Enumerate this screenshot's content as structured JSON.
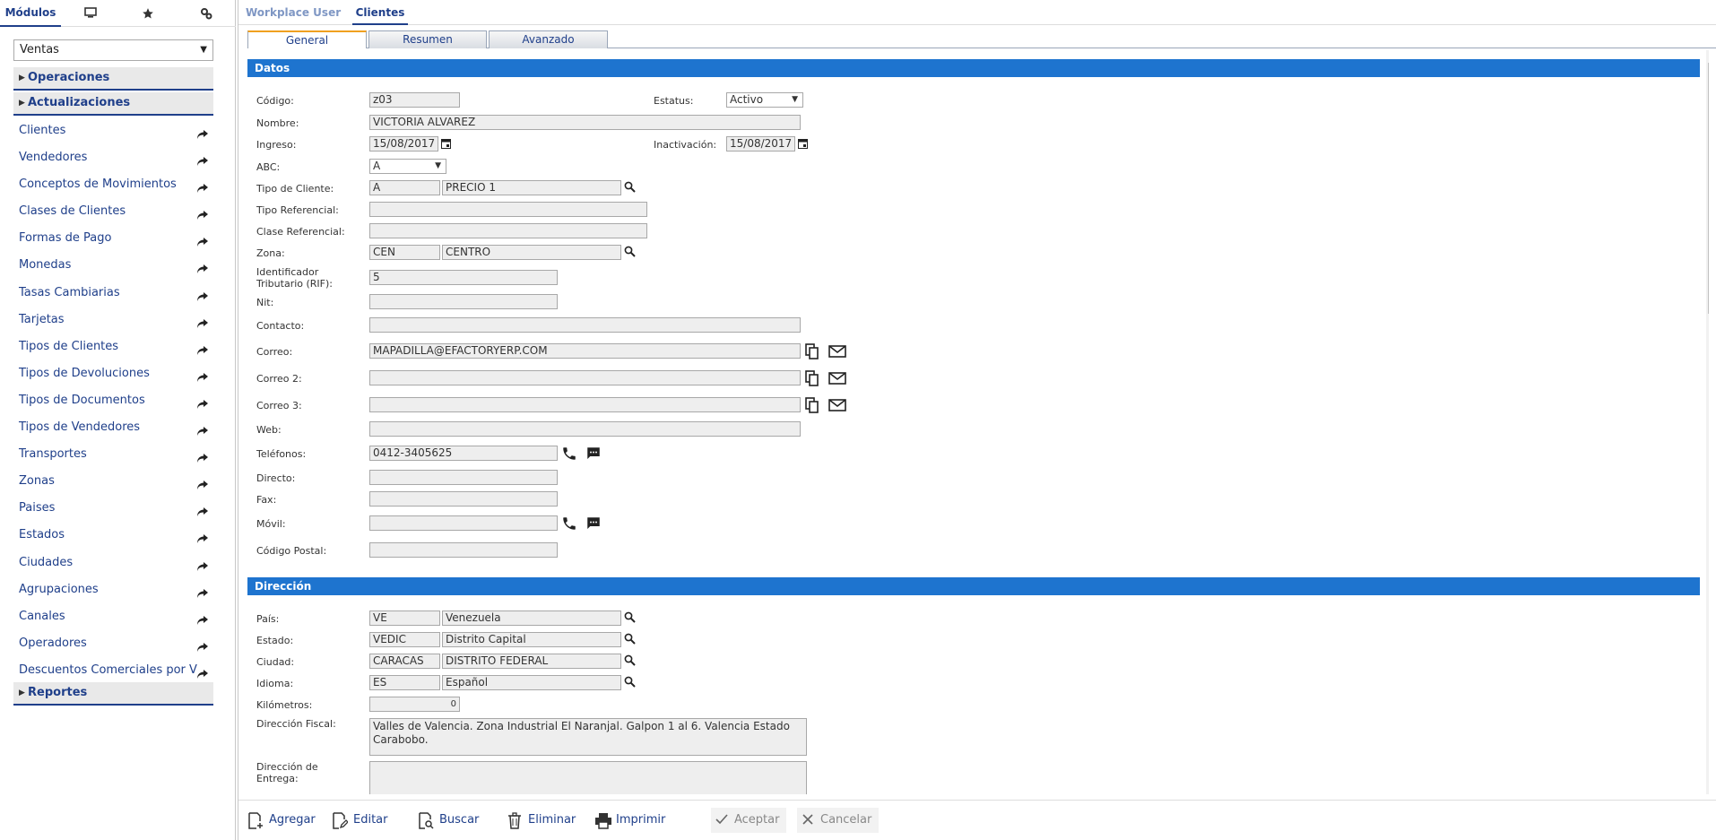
{
  "sidebar": {
    "tabs": {
      "modules": "Módulos",
      "icon1": "monitor-icon",
      "icon2": "star-icon",
      "icon3": "settings-icon"
    },
    "module_select": "Ventas",
    "groups": {
      "operaciones": "Operaciones",
      "actualizaciones": "Actualizaciones",
      "reportes": "Reportes"
    },
    "items": [
      "Clientes",
      "Vendedores",
      "Conceptos de Movimientos",
      "Clases de Clientes",
      "Formas de Pago",
      "Monedas",
      "Tasas Cambiarias",
      "Tarjetas",
      "Tipos de Clientes",
      "Tipos de Devoluciones",
      "Tipos de Documentos",
      "Tipos de Vendedores",
      "Transportes",
      "Zonas",
      "Paises",
      "Estados",
      "Ciudades",
      "Agrupaciones",
      "Canales",
      "Operadores",
      "Descuentos Comerciales por V"
    ]
  },
  "top_tabs": {
    "workplace": "Workplace User",
    "clientes": "Clientes"
  },
  "sub_tabs": {
    "general": "General",
    "resumen": "Resumen",
    "avanzado": "Avanzado"
  },
  "sections": {
    "datos": "Datos",
    "direccion": "Dirección"
  },
  "form": {
    "codigo": {
      "label": "Código:",
      "value": "z03"
    },
    "estatus": {
      "label": "Estatus:",
      "value": "Activo"
    },
    "nombre": {
      "label": "Nombre:",
      "value": "VICTORIA ALVAREZ"
    },
    "ingreso": {
      "label": "Ingreso:",
      "value": "15/08/2017"
    },
    "inactivacion": {
      "label": "Inactivación:",
      "value": "15/08/2017"
    },
    "abc": {
      "label": "ABC:",
      "value": "A"
    },
    "tipo_cliente": {
      "label": "Tipo de Cliente:",
      "code": "A",
      "desc": "PRECIO 1"
    },
    "tipo_referencial": {
      "label": "Tipo Referencial:",
      "value": ""
    },
    "clase_referencial": {
      "label": "Clase Referencial:",
      "value": ""
    },
    "zona": {
      "label": "Zona:",
      "code": "CEN",
      "desc": "CENTRO"
    },
    "rif": {
      "label1": "Identificador",
      "label2": "Tributario (RIF):",
      "value": "5"
    },
    "nit": {
      "label": "Nit:",
      "value": ""
    },
    "contacto": {
      "label": "Contacto:",
      "value": ""
    },
    "correo": {
      "label": "Correo:",
      "value": "MAPADILLA@EFACTORYERP.COM"
    },
    "correo2": {
      "label": "Correo 2:",
      "value": ""
    },
    "correo3": {
      "label": "Correo 3:",
      "value": ""
    },
    "web": {
      "label": "Web:",
      "value": ""
    },
    "telefonos": {
      "label": "Teléfonos:",
      "value": "0412-3405625"
    },
    "directo": {
      "label": "Directo:",
      "value": ""
    },
    "fax": {
      "label": "Fax:",
      "value": ""
    },
    "movil": {
      "label": "Móvil:",
      "value": ""
    },
    "codigo_postal": {
      "label": "Código Postal:",
      "value": ""
    }
  },
  "direccion": {
    "pais": {
      "label": "País:",
      "code": "VE",
      "desc": "Venezuela"
    },
    "estado": {
      "label": "Estado:",
      "code": "VEDIC",
      "desc": "Distrito Capital"
    },
    "ciudad": {
      "label": "Ciudad:",
      "code": "CARACAS",
      "desc": "DISTRITO FEDERAL"
    },
    "idioma": {
      "label": "Idioma:",
      "code": "ES",
      "desc": "Español"
    },
    "kilometros": {
      "label": "Kilómetros:",
      "value": "0"
    },
    "fiscal": {
      "label": "Dirección Fiscal:",
      "value": "Valles de Valencia. Zona Industrial El Naranjal. Galpon 1 al 6. Valencia Estado Carabobo."
    },
    "entrega": {
      "label1": "Dirección de",
      "label2": "Entrega:",
      "value": ""
    }
  },
  "toolbar": {
    "agregar": "Agregar",
    "editar": "Editar",
    "buscar": "Buscar",
    "eliminar": "Eliminar",
    "imprimir": "Imprimir",
    "aceptar": "Aceptar",
    "cancelar": "Cancelar"
  },
  "colors": {
    "accent": "#1e74cf",
    "nav": "#1f3f8a",
    "tab_highlight": "#f0a020"
  }
}
